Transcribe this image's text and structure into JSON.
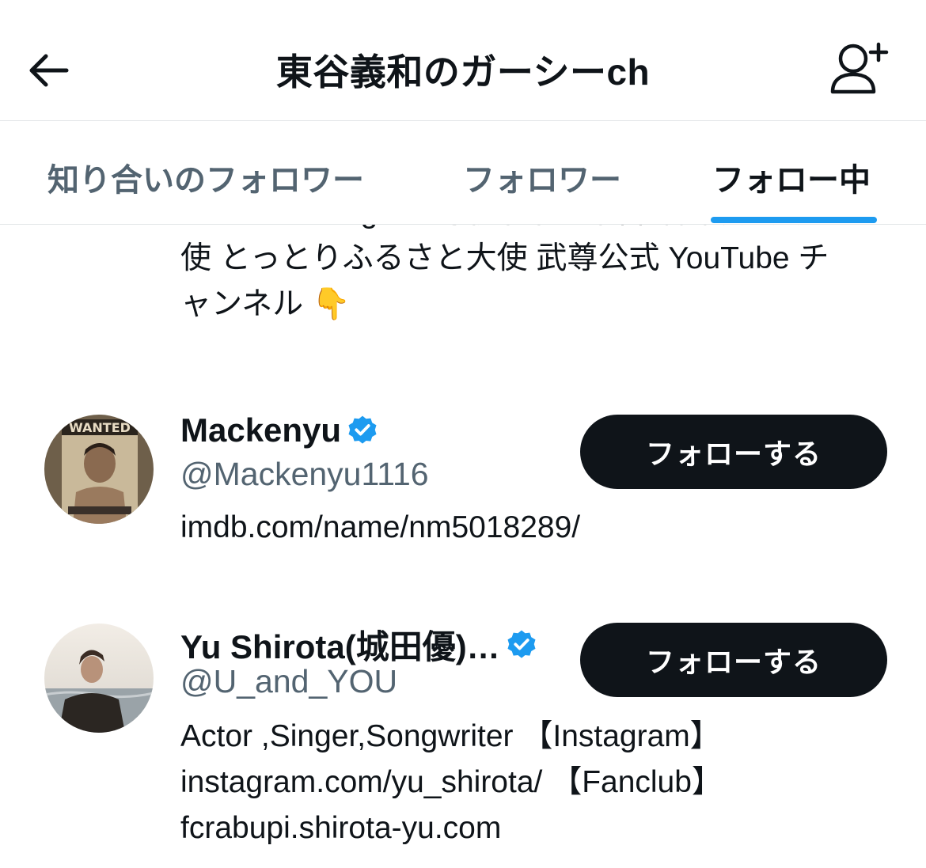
{
  "header": {
    "title": "東谷義和のガーシーch",
    "back_icon": "arrow-left-icon",
    "add_user_icon": "add-user-icon"
  },
  "tabs": [
    {
      "label": "知り合いのフォロワー",
      "active": false
    },
    {
      "label": "フォロワー",
      "active": false
    },
    {
      "label": "フォロー中",
      "active": true
    }
  ],
  "colors": {
    "accent": "#1d9bf0",
    "text_primary": "#0f1419",
    "text_secondary": "#536471",
    "button_bg": "#0f1419"
  },
  "list": {
    "partial_bio": {
      "lines": [
        "director&designer 鳥取県米子市首都圏観光大",
        "使 とっとりふるさと大使 武尊公式 YouTube チ",
        "ャンネル 👇"
      ]
    },
    "users": [
      {
        "name": "Mackenyu",
        "verified": true,
        "handle": "@Mackenyu1116",
        "follow_label": "フォローする",
        "bio_lines": [
          "imdb.com/name/nm5018289/"
        ]
      },
      {
        "name": "Yu Shirota(城田優)…",
        "verified": true,
        "handle": "@U_and_YOU",
        "follow_label": "フォローする",
        "bio_lines": [
          "Actor ,Singer,Songwriter 【Instagram】",
          "instagram.com/yu_shirota/ 【Fanclub】",
          "fcrabupi.shirota-yu.com"
        ]
      }
    ]
  }
}
